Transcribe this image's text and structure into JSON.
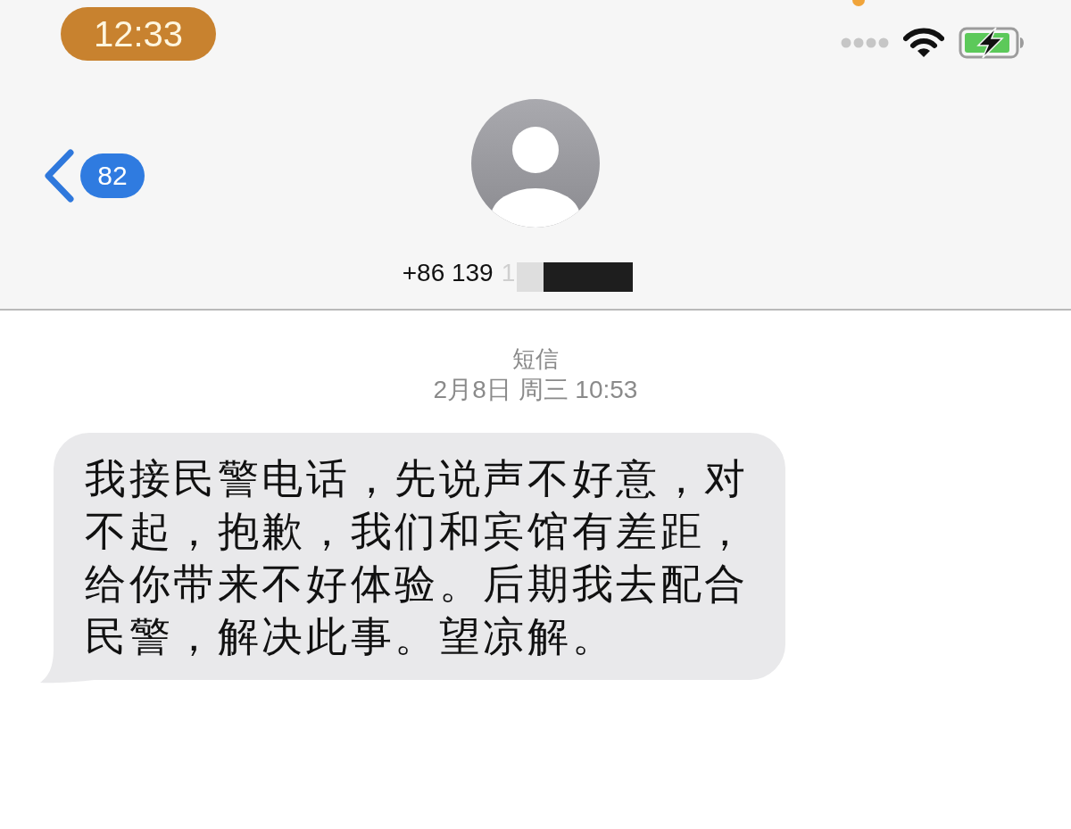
{
  "status_bar": {
    "time": "12:33"
  },
  "nav": {
    "back_badge": "82"
  },
  "contact": {
    "number": "+86 139",
    "number_partial": "1"
  },
  "thread": {
    "service": "短信",
    "timestamp": "2月8日 周三 10:53"
  },
  "messages": [
    {
      "kind": "incoming",
      "text": "我接民警电话，先说声不好意，对不起，抱歉，我们和宾馆有差距，给你带来不好体验。后期我去配合民警，解决此事。望凉解。"
    }
  ]
}
